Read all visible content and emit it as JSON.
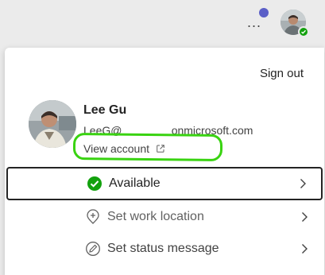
{
  "header": {
    "more_label": "...",
    "more_icon": "more-horizontal-icon",
    "notification_color": "#5b5fc7",
    "presence_color": "#13a10e"
  },
  "card": {
    "sign_out": "Sign out",
    "user": {
      "name": "Lee Gu",
      "email": "LeeG@                onmicrosoft.com",
      "view_account": "View account"
    },
    "status_items": [
      {
        "label": "Available",
        "icon": "available-check-icon",
        "selected": true
      },
      {
        "label": "Set work location",
        "icon": "location-add-icon",
        "selected": false
      },
      {
        "label": "Set status message",
        "icon": "status-edit-icon",
        "selected": false
      }
    ]
  },
  "annotation": {
    "highlight_color": "#39d311"
  }
}
